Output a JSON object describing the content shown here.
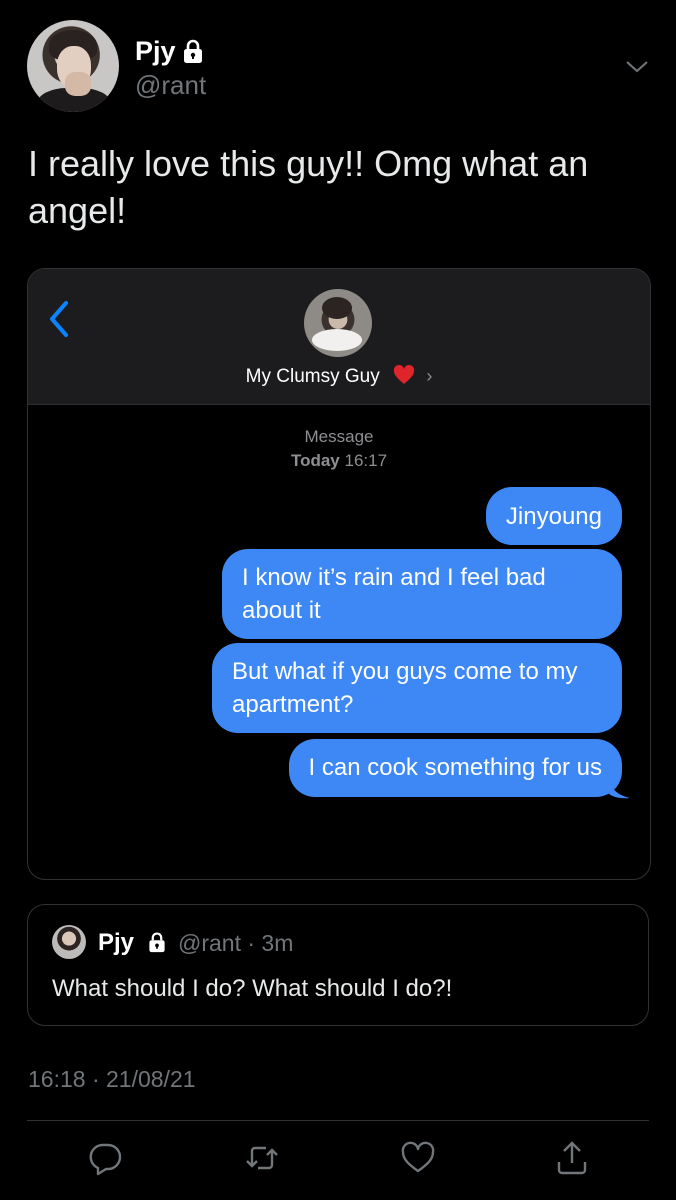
{
  "tweet": {
    "display_name": "Pjy",
    "handle": "@rant",
    "text": "I really love this guy!! Omg what an angel!",
    "timestamp": "16:18 · 21/08/21"
  },
  "message_screenshot": {
    "contact_name": "My Clumsy Guy",
    "meta_label": "Message",
    "meta_day": "Today",
    "meta_time": "16:17",
    "messages": [
      "Jinyoung",
      "I know it’s rain and I feel bad about it",
      "But what if you guys come to my apartment?",
      "I can cook something for us"
    ],
    "bubble_color": "#3d88f5"
  },
  "quoted_tweet": {
    "display_name": "Pjy",
    "handle_time": "@rant · 3m",
    "text": "What should I do? What should I do?!"
  },
  "actions": [
    "reply-icon",
    "retweet-icon",
    "like-icon",
    "share-icon"
  ],
  "colors": {
    "background": "#000000",
    "secondary_text": "#71767b",
    "ios_blue": "#0a84ff",
    "heart": "#e0242c"
  }
}
